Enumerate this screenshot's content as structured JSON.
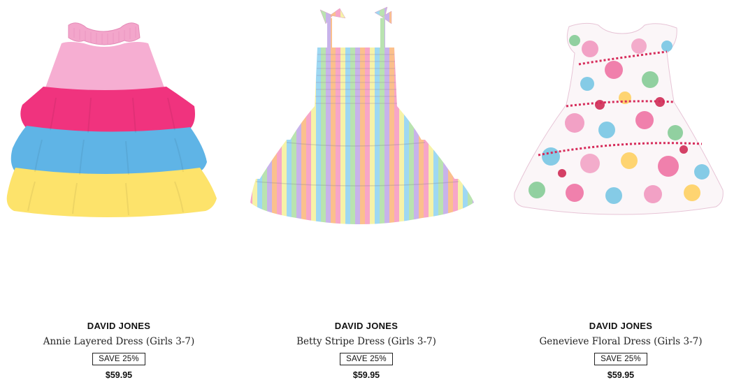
{
  "products": [
    {
      "image_icon": "pink-rainbow-layered-dress-image",
      "brand": "DAVID JONES",
      "name": "Annie Layered Dress (Girls 3-7)",
      "badge": "SAVE 25%",
      "price": "$59.95"
    },
    {
      "image_icon": "rainbow-stripe-dress-image",
      "brand": "DAVID JONES",
      "name": "Betty Stripe Dress (Girls 3-7)",
      "badge": "SAVE 25%",
      "price": "$59.95"
    },
    {
      "image_icon": "floral-dress-image",
      "brand": "DAVID JONES",
      "name": "Genevieve Floral Dress (Girls 3-7)",
      "badge": "SAVE 25%",
      "price": "$59.95"
    }
  ],
  "colors": {
    "layer_pink_light": "#f6a9cf",
    "layer_pink_hot": "#f0337e",
    "layer_blue": "#5fb4e6",
    "layer_yellow": "#fde36b",
    "text": "#111111"
  }
}
